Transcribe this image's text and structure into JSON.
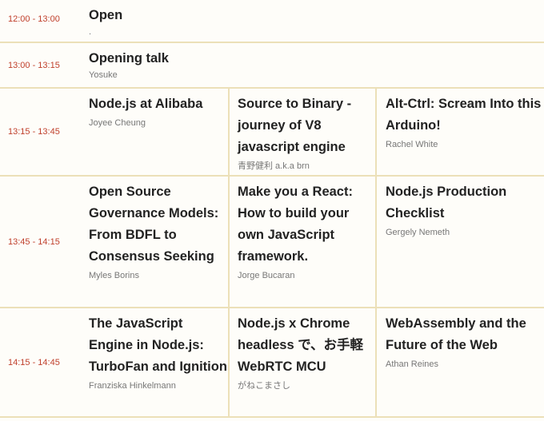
{
  "rows": [
    {
      "time": "12:00 - 13:00",
      "sessions": [
        {
          "title": "Open",
          "speaker": "."
        }
      ]
    },
    {
      "time": "13:00 - 13:15",
      "sessions": [
        {
          "title": "Opening talk",
          "speaker": "Yosuke"
        }
      ]
    },
    {
      "time": "13:15 - 13:45",
      "sessions": [
        {
          "title": "Node.js at Alibaba",
          "speaker": "Joyee Cheung"
        },
        {
          "title": "Source to Binary - journey of V8 javascript engine",
          "speaker": "青野健利 a.k.a brn"
        },
        {
          "title": "Alt-Ctrl: Scream Into this Arduino!",
          "speaker": "Rachel White"
        }
      ]
    },
    {
      "time": "13:45 - 14:15",
      "sessions": [
        {
          "title": "Open Source Governance Models: From BDFL to Consensus Seeking",
          "speaker": "Myles Borins"
        },
        {
          "title": "Make you a React: How to build your own JavaScript framework.",
          "speaker": "Jorge Bucaran"
        },
        {
          "title": "Node.js Production Checklist",
          "speaker": "Gergely Nemeth"
        }
      ]
    },
    {
      "time": "14:15 - 14:45",
      "sessions": [
        {
          "title": "The JavaScript Engine in Node.js: TurboFan and Ignition",
          "speaker": "Franziska Hinkelmann"
        },
        {
          "title": "Node.js x Chrome headless で、お手軽WebRTC MCU",
          "speaker": "がねこまさし"
        },
        {
          "title": "WebAssembly and the Future of the Web",
          "speaker": "Athan Reines"
        }
      ]
    }
  ]
}
